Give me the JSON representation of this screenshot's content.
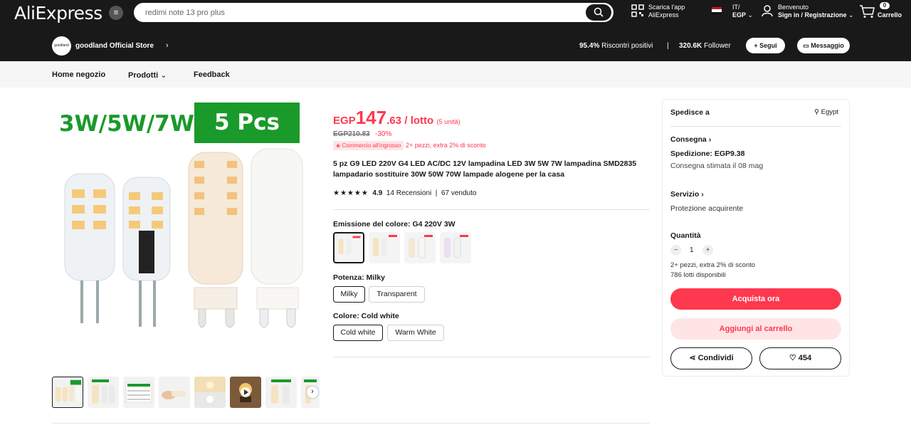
{
  "header": {
    "logo": "AliExpress",
    "search_value": "redimi note 13 pro plus",
    "app_line1": "Scarica l'app",
    "app_line2": "AliExpress",
    "lang_line1": "IT/",
    "lang_line2": "EGP",
    "account_line1": "Benvenuto",
    "account_line2": "Sign in / Registrazione",
    "cart_count": "0",
    "cart_label": "Carrello"
  },
  "store": {
    "logo_text": "goodland",
    "name": "goodland Official Store",
    "feedback_value": "95.4%",
    "feedback_label": "Riscontri positivi",
    "separator": "|",
    "followers": "320.6K",
    "followers_label": "Follower",
    "follow_btn": "Segui",
    "message_btn": "Messaggio"
  },
  "subnav": {
    "home": "Home negozio",
    "products": "Prodotti",
    "feedback": "Feedback"
  },
  "product_image": {
    "banner_left": "3W/5W/7W",
    "banner_right": "5 Pcs"
  },
  "price": {
    "currency": "EGP",
    "integer": "147",
    "decimal": ".63",
    "unit": "/ lotto",
    "lot_note": "(5 unità)",
    "old": "EGP210.83",
    "discount": "-30%",
    "bulk_tag": "Commercio all'ingrosso",
    "extra_discount": "2+ pezzi, extra 2% di sconto"
  },
  "title": "5 pz G9 LED 220V G4 LED AC/DC 12V lampadina LED 3W 5W 7W lampadina SMD2835 lampadario sostituire 30W 50W 70W lampade alogene per la casa",
  "rating": {
    "stars": "★★★★★",
    "score": "4.9",
    "reviews": "14 Recensioni",
    "separator": "|",
    "sold": "67 venduto"
  },
  "options": {
    "color_emission_label": "Emissione del colore: G4 220V 3W",
    "power_label": "Potenza: Milky",
    "power_options": [
      "Milky",
      "Transparent"
    ],
    "color_label": "Colore: Cold white",
    "color_options": [
      "Cold white",
      "Warm White"
    ]
  },
  "side": {
    "ships_to": "Spedisce a",
    "country": "Egypt",
    "delivery": "Consegna",
    "shipping": "Spedizione: EGP9.38",
    "estimated": "Consegna stimata il 08 mag",
    "service": "Servizio",
    "protection": "Protezione acquirente",
    "quantity_label": "Quantità",
    "quantity_value": "1",
    "qty_extra": "2+ pezzi, extra 2% di sconto",
    "available": "786 lotti disponibili",
    "buy_now": "Acquista ora",
    "add_cart": "Aggiungi al carrello",
    "share": "Condividi",
    "wishlist_count": "454"
  },
  "colors": {
    "accent": "#fd384f",
    "accent_light": "#ffe4e6",
    "dark": "#191919",
    "banner_green": "#1a9a2a"
  }
}
